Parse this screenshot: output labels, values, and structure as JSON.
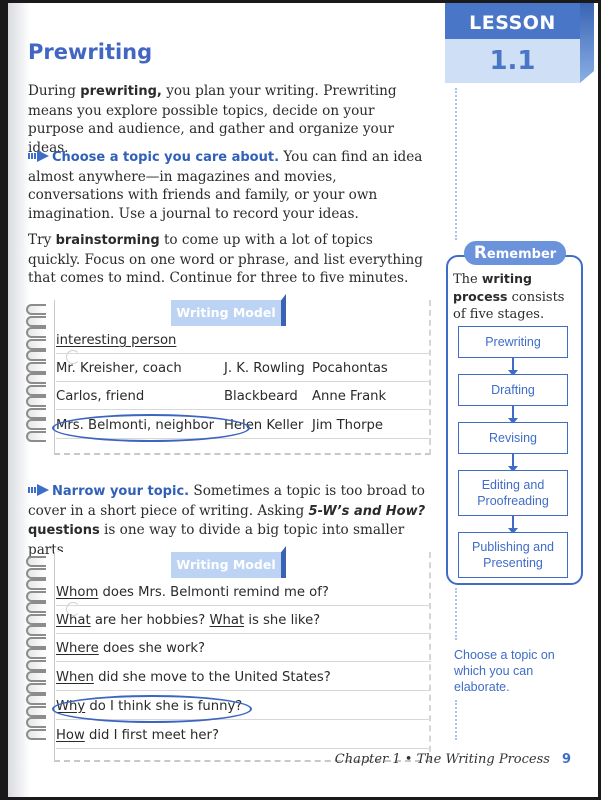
{
  "lesson": {
    "label": "LESSON",
    "number": "1.1"
  },
  "title": "Prewriting",
  "intro": {
    "pre": "During ",
    "bold": "prewriting,",
    "post": " you plan your writing. Prewriting means you explore possible topics, decide on your purpose and audience, and gather and organize your ideas."
  },
  "tip1": {
    "lead": "Choose a topic you care about.",
    "text": " You can find an idea almost anywhere—in magazines and movies, conversations with friends and family, or your own imagination. Use a journal to record your ideas."
  },
  "brainstorm": {
    "pre": "Try ",
    "bold": "brainstorming",
    "post": " to come up with a lot of topics quickly. Focus on one word or phrase, and list everything that comes to mind. Continue for three to five minutes."
  },
  "model1": {
    "label": "Writing Model",
    "heading": "interesting person",
    "rows": [
      [
        "Mr. Kreisher, coach",
        "J. K. Rowling",
        "Pocahontas"
      ],
      [
        "Carlos, friend",
        "Blackbeard",
        "Anne Frank"
      ],
      [
        "Mrs. Belmonti, neighbor",
        "Helen Keller",
        "Jim Thorpe"
      ]
    ],
    "circled": "Mrs. Belmonti, neighbor"
  },
  "tip2": {
    "lead": "Narrow your topic.",
    "text1": " Sometimes a topic is too broad to cover in a short piece of writing. Asking ",
    "italic": "5-W’s and How?",
    "bold": " questions",
    "text2": " is one way to divide a big topic into smaller parts."
  },
  "model2": {
    "label": "Writing Model",
    "questions": [
      {
        "word": "Whom",
        "rest": " does Mrs. Belmonti remind me of?"
      },
      {
        "word": "What",
        "rest": " are her hobbies? ",
        "word2": "What",
        "rest2": " is she like?"
      },
      {
        "word": "Where",
        "rest": " does she work?"
      },
      {
        "word": "When",
        "rest": " did she move to the United States?"
      },
      {
        "word": "Why",
        "rest": " do I think she is funny?"
      },
      {
        "word": "How",
        "rest": " did I first meet her?"
      }
    ],
    "circled_index": 4
  },
  "remember": {
    "tab_initial": "R",
    "tab_rest": "emember",
    "text_pre": "The ",
    "text_bold": "writing process",
    "text_post": " consists of five stages.",
    "stages": [
      "Prewriting",
      "Drafting",
      "Revising",
      "Editing and Proofreading",
      "Publishing and Presenting"
    ]
  },
  "side_tip": "Choose a topic on which you can elaborate.",
  "footer": {
    "chapter": "Chapter 1 • The Writing Process",
    "page": "9"
  }
}
